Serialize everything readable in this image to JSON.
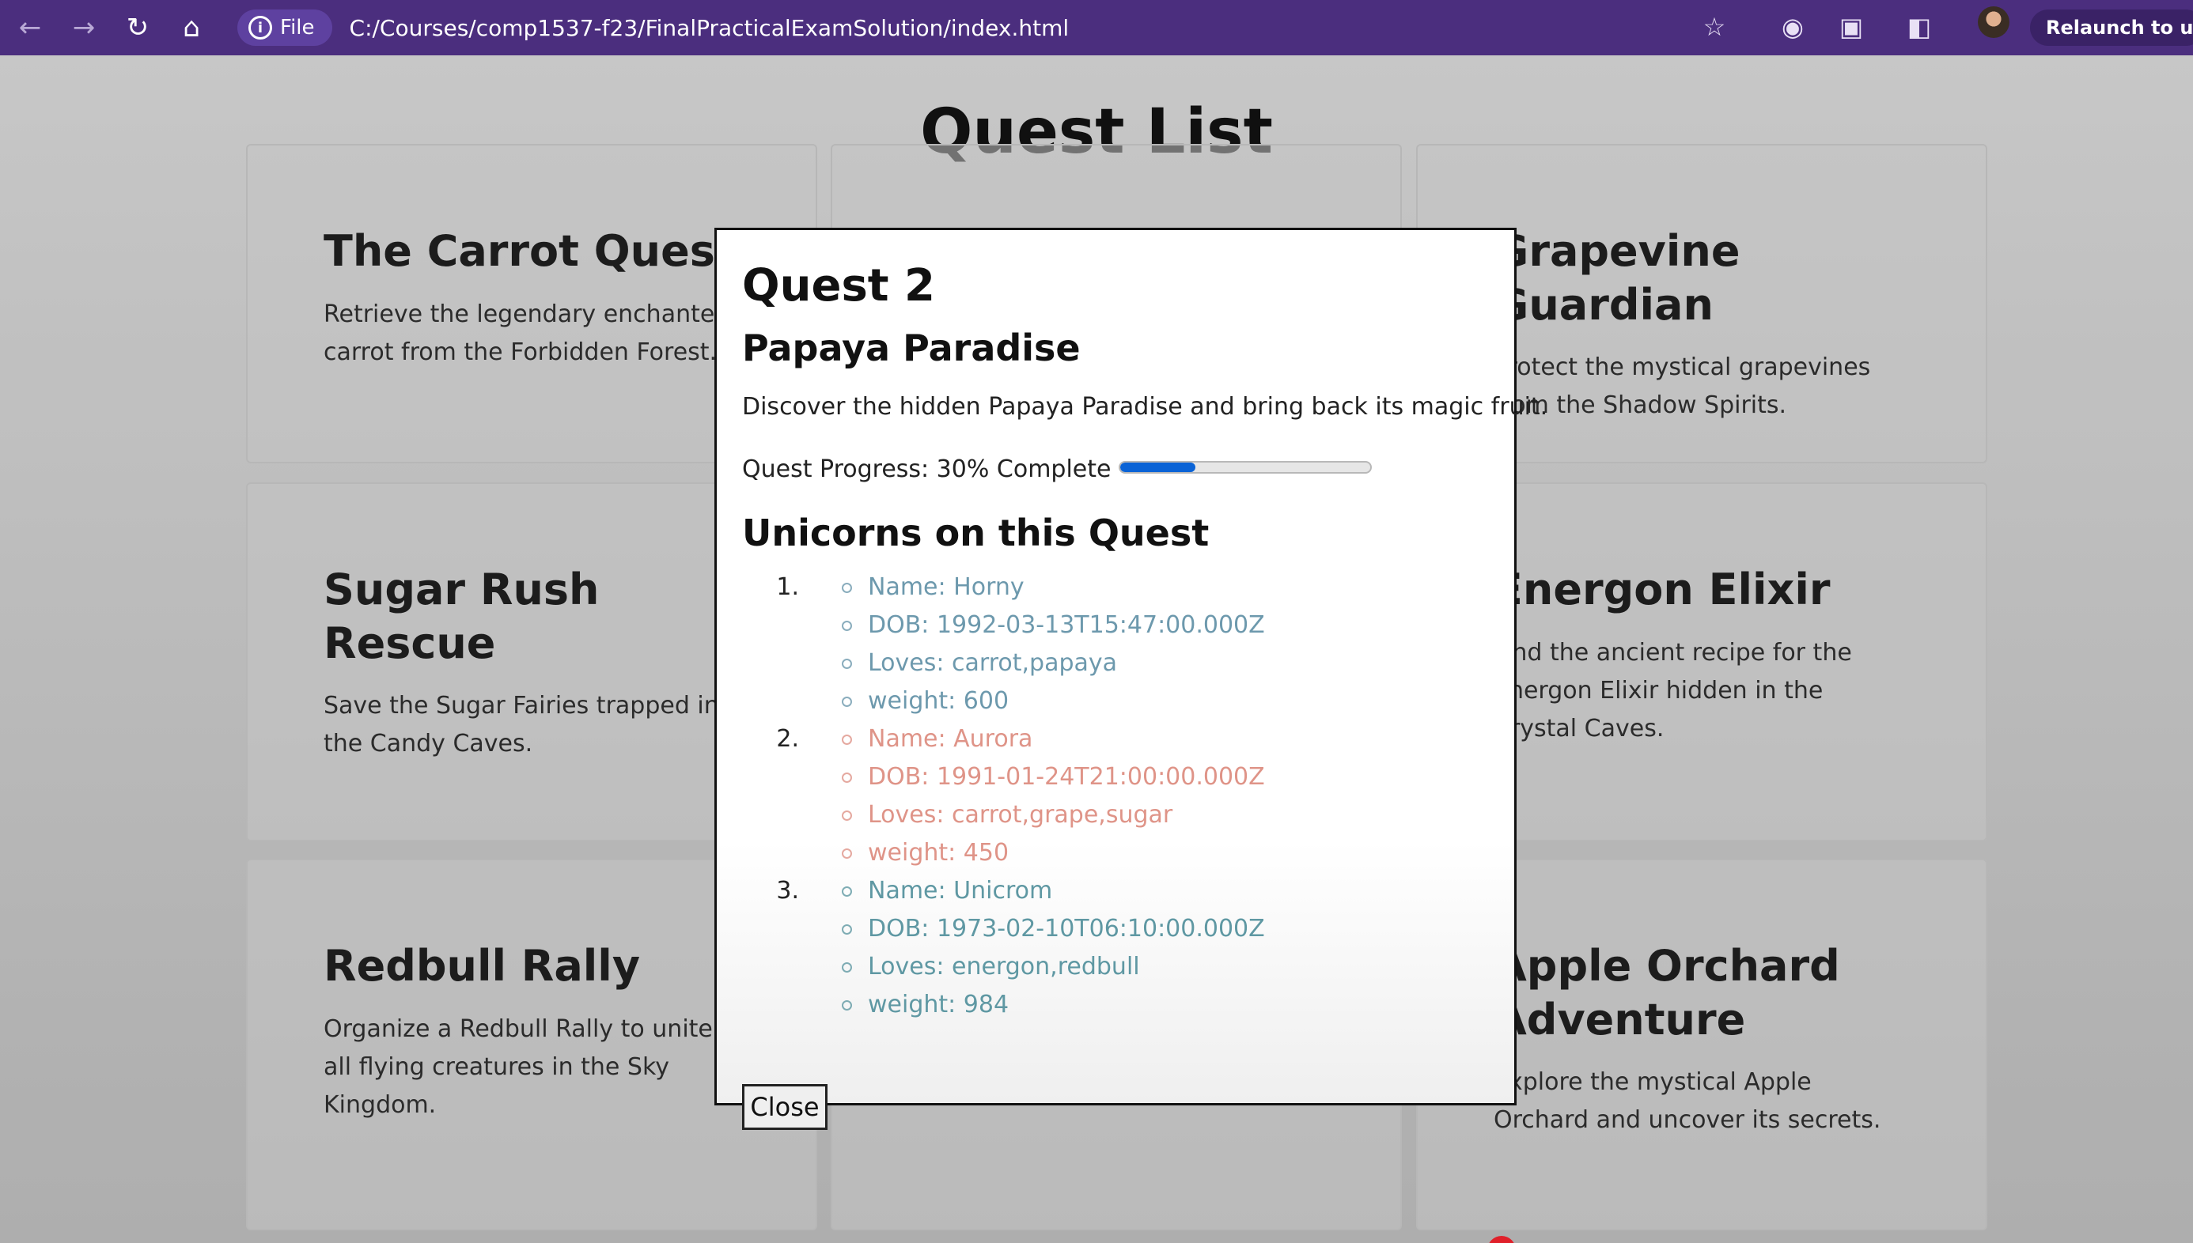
{
  "browser": {
    "file_chip": "File",
    "url": "C:/Courses/comp1537-f23/FinalPracticalExamSolution/index.html",
    "relaunch_label": "Relaunch to upda",
    "icons": [
      "back-icon",
      "forward-icon",
      "reload-icon",
      "home-icon",
      "info-icon",
      "star-icon",
      "camera-icon",
      "extension-icon",
      "sidepanel-icon"
    ]
  },
  "page": {
    "title": "Quest List",
    "cards": [
      {
        "title": "The Carrot Quest",
        "desc": "Retrieve the legendary enchanted carrot from the Forbidden Forest."
      },
      {
        "title": "Grapevine Guardian",
        "desc": "Protect the mystical grapevines from the Shadow Spirits."
      },
      {
        "title": "Sugar Rush Rescue",
        "desc": "Save the Sugar Fairies trapped in the Candy Caves."
      },
      {
        "title": "Energon Elixir",
        "desc": "Find the ancient recipe for the Energon Elixir hidden in the Crystal Caves."
      },
      {
        "title": "Redbull Rally",
        "desc": "Organize a Redbull Rally to unite all flying creatures in the Sky Kingdom."
      },
      {
        "title": "Apple Orchard Adventure",
        "desc": "Explore the mystical Apple Orchard and uncover its secrets."
      }
    ]
  },
  "modal": {
    "heading": "Quest 2",
    "quest_name": "Papaya Paradise",
    "description": "Discover the hidden Papaya Paradise and bring back its magic fruit.",
    "progress_label": "Quest Progress: 30% Complete",
    "progress_value": 0.3,
    "unicorns_heading": "Unicorns on this Quest",
    "unicorns": [
      {
        "number": "1.",
        "color": "#6d99ad",
        "name": "Name: Horny",
        "dob": "DOB: 1992-03-13T15:47:00.000Z",
        "loves": "Loves: carrot,papaya",
        "weight": "weight: 600"
      },
      {
        "number": "2.",
        "color": "#df9488",
        "name": "Name: Aurora",
        "dob": "DOB: 1991-01-24T21:00:00.000Z",
        "loves": "Loves: carrot,grape,sugar",
        "weight": "weight: 450"
      },
      {
        "number": "3.",
        "color": "#5f98a3",
        "name": "Name: Unicrom",
        "dob": "DOB: 1973-02-10T06:10:00.000Z",
        "loves": "Loves: energon,redbull",
        "weight": "weight: 984"
      }
    ],
    "close_label": "Close"
  }
}
